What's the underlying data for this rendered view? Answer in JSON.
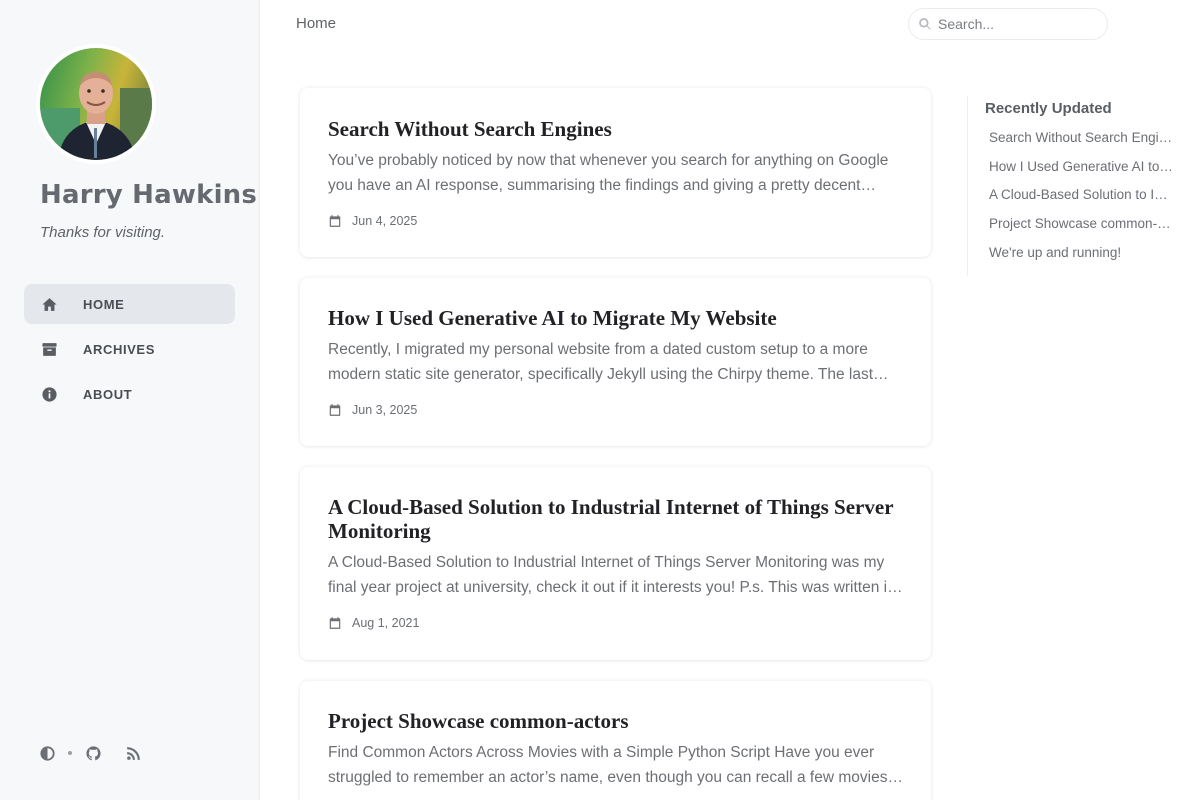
{
  "sidebar": {
    "title": "Harry Hawkins",
    "subtitle": "Thanks for visiting.",
    "nav": [
      {
        "label": "HOME",
        "icon": "home-icon",
        "active": true
      },
      {
        "label": "ARCHIVES",
        "icon": "archive-icon",
        "active": false
      },
      {
        "label": "ABOUT",
        "icon": "info-icon",
        "active": false
      }
    ],
    "bottom_icons": [
      "theme-toggle-icon",
      "github-icon",
      "rss-icon"
    ]
  },
  "topbar": {
    "breadcrumb": "Home",
    "search_placeholder": "Search..."
  },
  "posts": [
    {
      "title": "Search Without Search Engines",
      "excerpt": "You’ve probably noticed by now that whenever you search for anything on Google you have an AI response, summarising the findings and giving a pretty decent…",
      "date": "Jun 4, 2025"
    },
    {
      "title": "How I Used Generative AI to Migrate My Website",
      "excerpt": "Recently, I migrated my personal website from a dated custom setup to a more modern static site generator, specifically Jekyll using the Chirpy theme. The last…",
      "date": "Jun 3, 2025"
    },
    {
      "title": "A Cloud-Based Solution to Industrial Internet of Things Server Monitoring",
      "excerpt": "A Cloud-Based Solution to Industrial Internet of Things Server Monitoring was my final year project at university, check it out if it interests you! P.s. This was written i…",
      "date": "Aug 1, 2021"
    },
    {
      "title": "Project Showcase common-actors",
      "excerpt": "Find Common Actors Across Movies with a Simple Python Script Have you ever struggled to remember an actor’s name, even though you can recall a few movies…",
      "date": ""
    }
  ],
  "recently_updated": {
    "title": "Recently Updated",
    "items": [
      "Search Without Search Engines",
      "How I Used Generative AI to …",
      "A Cloud-Based Solution to In…",
      "Project Showcase common-a…",
      "We're up and running!"
    ]
  },
  "colors": {
    "sidebar_bg": "#f6f8fa",
    "active_nav_bg": "#e4e8ed",
    "title_text": "#666a70"
  }
}
